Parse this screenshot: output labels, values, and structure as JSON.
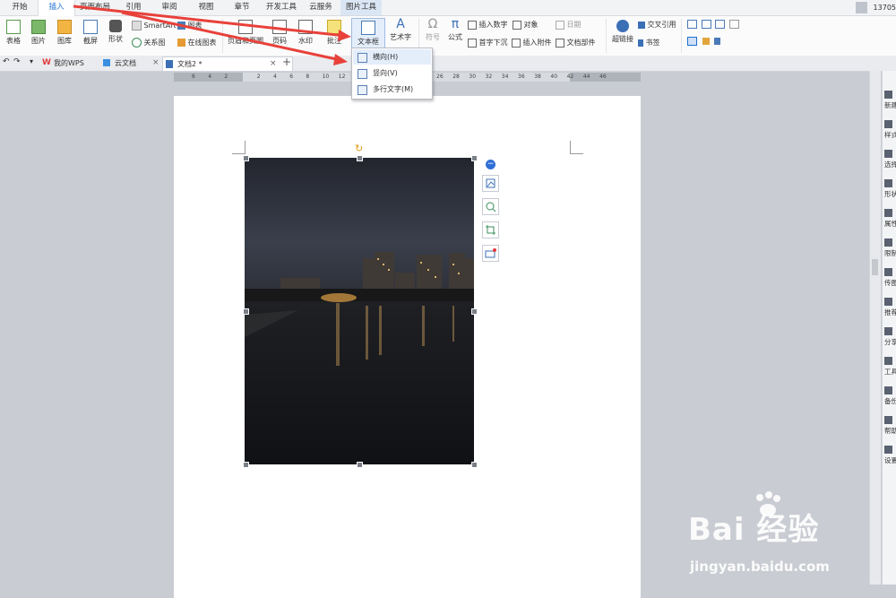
{
  "menu_tabs": [
    "开始",
    "插入",
    "页面布局",
    "引用",
    "审阅",
    "视图",
    "章节",
    "开发工具",
    "云服务",
    "图片工具"
  ],
  "user_id": "13705",
  "ribbon": {
    "table": "表格",
    "picture": "图片",
    "gallery": "图库",
    "screenshot": "截屏",
    "shapes": "形状",
    "smartart": "SmartArt",
    "relation": "关系图",
    "chart": "图表",
    "online_chart": "在线图表",
    "header_footer": "页眉和页脚",
    "page_number": "页码",
    "watermark": "水印",
    "comment": "批注",
    "textbox": "文本框",
    "wordart": "艺术字",
    "symbol": "符号",
    "formula": "公式",
    "insert_number": "插入数字",
    "object": "对象",
    "date": "日期",
    "dropcap": "首字下沉",
    "attachment": "插入附件",
    "doc_parts": "文档部件",
    "hyperlink": "超链接",
    "cross_ref": "交叉引用",
    "bookmark": "书签"
  },
  "doc_tabs": {
    "mywps": "我的WPS",
    "cloud": "云文档",
    "doc": "文档2 *",
    "new_tab": "+"
  },
  "ruler_ticks": [
    "6",
    "4",
    "2",
    "",
    "2",
    "4",
    "6",
    "8",
    "10",
    "12",
    "",
    "",
    "",
    "",
    "",
    "26",
    "28",
    "30",
    "32",
    "34",
    "36",
    "38",
    "40",
    "42",
    "44",
    "46"
  ],
  "dropdown": {
    "items": [
      "横向(H)",
      "竖向(V)",
      "多行文字(M)"
    ]
  },
  "right_pane": [
    "新建",
    "样式",
    "选择",
    "形状",
    "属性",
    "限制",
    "传图",
    "推荐",
    "分享",
    "工具",
    "备份",
    "帮助",
    "设置"
  ],
  "watermark": {
    "logo": "Bai 经验",
    "url": "jingyan.baidu.com"
  },
  "colors": {
    "accent": "#1e6fd0",
    "arrow": "#e8413a",
    "page_bg": "#c9ccd2"
  }
}
